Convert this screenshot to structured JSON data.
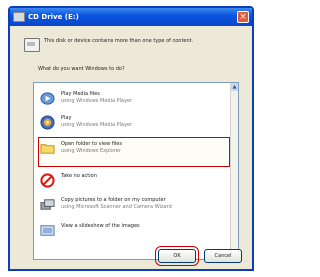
{
  "window": {
    "title": "CD Drive (E:)",
    "close_glyph": "×"
  },
  "description": "This disk or device contains more than one type of content.",
  "question": "What do you want Windows to do?",
  "options": [
    {
      "label": "Play Media files",
      "sub": "using Windows Media Player",
      "icon": "media-player-icon"
    },
    {
      "label": "Play",
      "sub": "using Windows Media Player",
      "icon": "play-disc-icon"
    },
    {
      "label": "Open folder to view files",
      "sub": "using Windows Explorer",
      "icon": "folder-icon",
      "selected": true
    },
    {
      "label": "Take no action",
      "sub": "",
      "icon": "no-action-icon"
    },
    {
      "label": "Copy pictures to a folder on my computer",
      "sub": "using Microsoft Scanner and Camera Wizard",
      "icon": "copy-pictures-icon"
    },
    {
      "label": "View a slideshow of the images",
      "sub": "",
      "icon": "slideshow-icon"
    }
  ],
  "buttons": {
    "ok": "OK",
    "cancel": "Cancel"
  },
  "colors": {
    "highlight": "#cc0000",
    "titlebar": "#0a45c9"
  }
}
